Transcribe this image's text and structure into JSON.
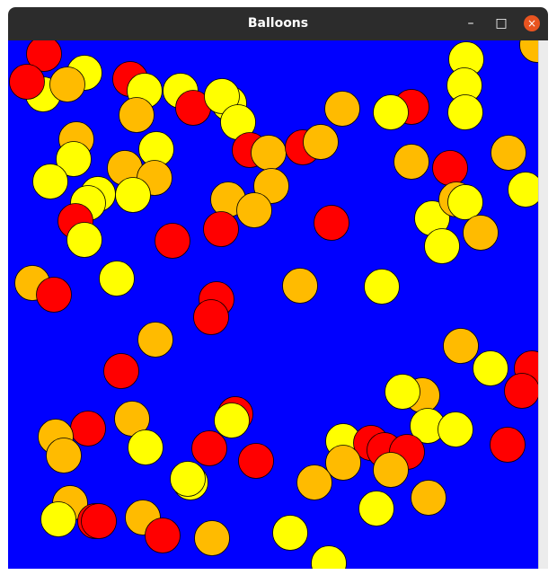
{
  "window": {
    "title": "Balloons",
    "buttons": {
      "minimize": "–",
      "maximize": "□",
      "close": "×"
    }
  },
  "scene": {
    "background_color": "#0000ff",
    "outline_color": "#000000",
    "colors": {
      "red": "#ff0000",
      "orange": "#ffbb00",
      "yellow": "#ffff00"
    },
    "balloon_count": 127
  }
}
